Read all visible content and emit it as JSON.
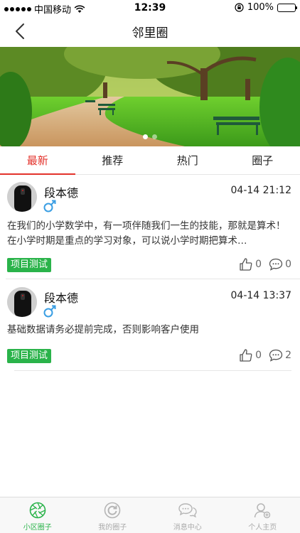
{
  "status_bar": {
    "carrier": "中国移动",
    "time": "12:39",
    "battery": "100%",
    "icons": [
      "signal-dots-icon",
      "wifi-icon",
      "orientation-lock-icon",
      "battery-icon"
    ]
  },
  "nav": {
    "title": "邻里圈",
    "back_icon": "chevron-left-icon"
  },
  "banner": {
    "image": "park-path-trees-benches",
    "page_count": 2,
    "active_page": 1
  },
  "tabs": [
    {
      "label": "最新",
      "active": true
    },
    {
      "label": "推荐",
      "active": false
    },
    {
      "label": "热门",
      "active": false
    },
    {
      "label": "圈子",
      "active": false
    }
  ],
  "posts": [
    {
      "author": "段本德",
      "gender_icon": "male-icon",
      "time": "04-14 21:12",
      "content": "在我们的小学数学中，有一项伴随我们一生的技能，那就是算术！在小学时期是重点的学习对象，可以说小学时期把算术…",
      "tag": "项目测试",
      "likes": "0",
      "comments": "0"
    },
    {
      "author": "段本德",
      "gender_icon": "male-icon",
      "time": "04-14 13:37",
      "content": "基础数据请务必提前完成，否则影响客户使用",
      "tag": "项目测试",
      "likes": "0",
      "comments": "2"
    }
  ],
  "bottom_tabs": [
    {
      "label": "小区圈子",
      "icon": "aperture-icon",
      "active": true
    },
    {
      "label": "我的圈子",
      "icon": "refresh-circle-icon",
      "active": false
    },
    {
      "label": "消息中心",
      "icon": "chat-bubbles-icon",
      "active": false
    },
    {
      "label": "个人主页",
      "icon": "user-icon",
      "active": false
    }
  ],
  "colors": {
    "accent_red": "#e3322b",
    "tag_green": "#2ab34a",
    "battery_green": "#34c759"
  }
}
